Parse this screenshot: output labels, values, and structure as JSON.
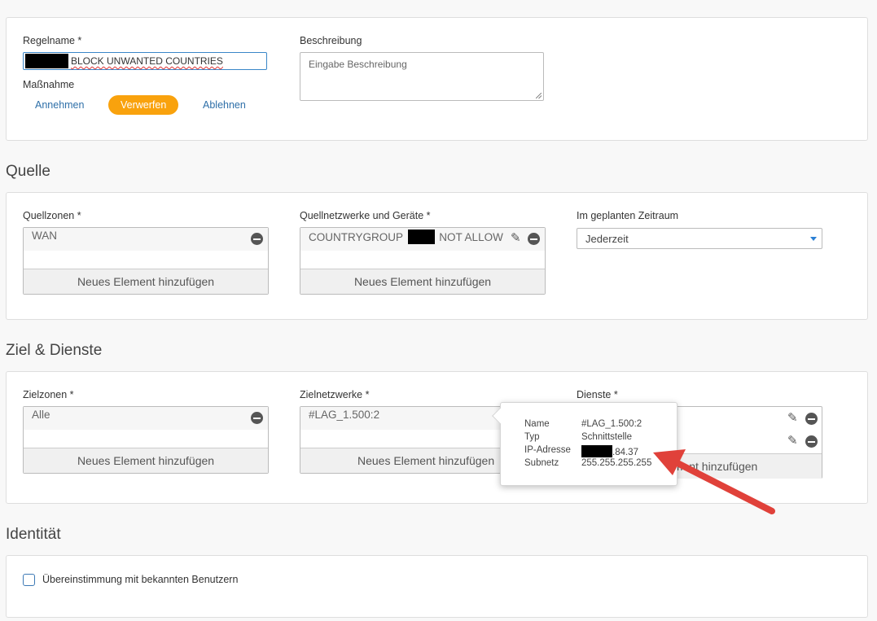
{
  "rule": {
    "name_label": "Regelname *",
    "name_value": "BLOCK UNWANTED COUNTRIES",
    "action_label": "Maßnahme",
    "actions": [
      "Annehmen",
      "Verwerfen",
      "Ablehnen"
    ],
    "active_action": "Verwerfen",
    "description_label": "Beschreibung",
    "description_placeholder": "Eingabe Beschreibung"
  },
  "source": {
    "title": "Quelle",
    "zones_label": "Quellzonen *",
    "zones_value": "WAN",
    "networks_label": "Quellnetzwerke und Geräte *",
    "networks_value_prefix": "COUNTRYGROUP",
    "networks_value_suffix": "NOT ALLOW",
    "schedule_label": "Im geplanten Zeitraum",
    "schedule_value": "Jederzeit",
    "add_label": "Neues Element hinzufügen"
  },
  "destination": {
    "title": "Ziel & Dienste",
    "zones_label": "Zielzonen *",
    "zones_value": "Alle",
    "networks_label": "Zielnetzwerke *",
    "networks_value": "#LAG_1.500:2",
    "services_label": "Dienste *",
    "add_label": "Neues Element hinzufügen",
    "services_add_partial": "ement hinzufügen"
  },
  "tooltip": {
    "rows": [
      {
        "key": "Name",
        "value": "#LAG_1.500:2"
      },
      {
        "key": "Typ",
        "value": "Schnittstelle"
      },
      {
        "key": "IP-Adresse",
        "value": ".84.37"
      },
      {
        "key": "Subnetz",
        "value": "255.255.255.255"
      }
    ]
  },
  "identity": {
    "title": "Identität",
    "match_label": "Übereinstimmung mit bekannten Benutzern"
  },
  "colors": {
    "accent": "#f9a20d",
    "link": "#2e6fa8",
    "arrow": "#e0413a"
  }
}
